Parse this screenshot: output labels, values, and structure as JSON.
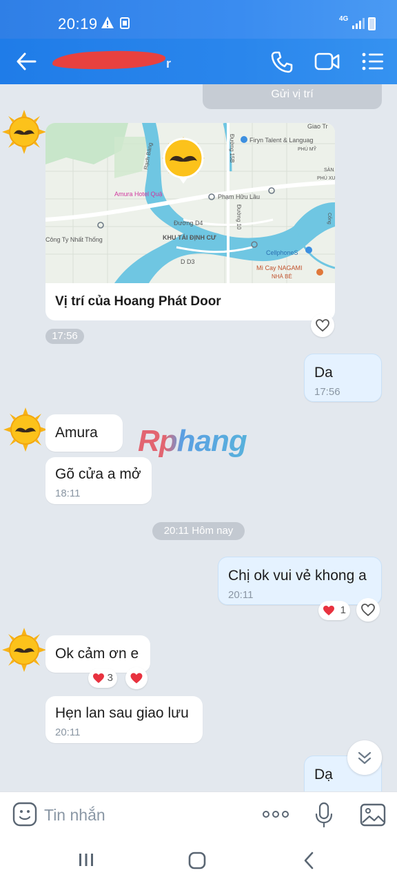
{
  "status_bar": {
    "time": "20:19",
    "network": "4G"
  },
  "header": {
    "contact_name_redacted_tail": "r"
  },
  "chat": {
    "location_sent_label": "Gửi vị trí",
    "map_card": {
      "title": "Vị trí của Hoang Phát Door",
      "map_labels": {
        "amura": "Amura Hotel Quậ",
        "pham_huu_lau": "Phạm Hữu Lầu",
        "duong_15b": "Đường 15B",
        "duong_d4": "Đường D4",
        "duong_d3": "D D3",
        "khu_tai_dinh_cu": "KHU TÁI ĐỊNH CƯ",
        "cong_ty_nhat_thong": "Công Ty Nhất Thống",
        "rach_bang": "Rạch Bàng",
        "firyn": "Firyn Talent & Languag",
        "phu_my": "PHÚ MỸ",
        "giao_tr": "Giao Tr",
        "san": "SÀN",
        "phu_xu": "PHÚ XU",
        "cellphones": "CellphoneS",
        "mi_cay": "Mì Cay NAGAMI",
        "nha_be": "NHÀ BÈ",
        "duong_10": "Đường 10",
        "cong": "Cống"
      },
      "time": "17:56"
    },
    "messages": [
      {
        "id": "da1",
        "text": "Da",
        "time": "17:56"
      },
      {
        "id": "amura",
        "text": "Amura"
      },
      {
        "id": "go-cua",
        "text": "Gõ cửa a mở",
        "time": "18:11"
      },
      {
        "id": "chi-ok",
        "text": "Chị ok vui vẻ khong a",
        "time": "20:11",
        "reaction_count": "1"
      },
      {
        "id": "ok-cam-on",
        "text": "Ok cảm ơn e",
        "reaction_count": "3"
      },
      {
        "id": "hen-lan-sau",
        "text": "Hẹn lan sau giao lưu",
        "time": "20:11"
      },
      {
        "id": "da2",
        "text": "Dạ"
      }
    ],
    "date_divider": "20:11 Hôm nay",
    "watermark": "Rphang"
  },
  "composer": {
    "placeholder": "Tin nhắn"
  },
  "colors": {
    "header": "#2a86ec",
    "chat_bg": "#e3e8ee",
    "my_bubble": "#e5f2ff",
    "heart": "#e8323f"
  },
  "icons": [
    "back-arrow-icon",
    "phone-icon",
    "video-camera-icon",
    "list-menu-icon",
    "heart-outline-icon",
    "heart-filled-icon",
    "chevron-double-down-icon",
    "sticker-icon",
    "more-dots-icon",
    "microphone-icon",
    "image-icon",
    "recents-icon",
    "home-icon",
    "nav-back-icon"
  ]
}
